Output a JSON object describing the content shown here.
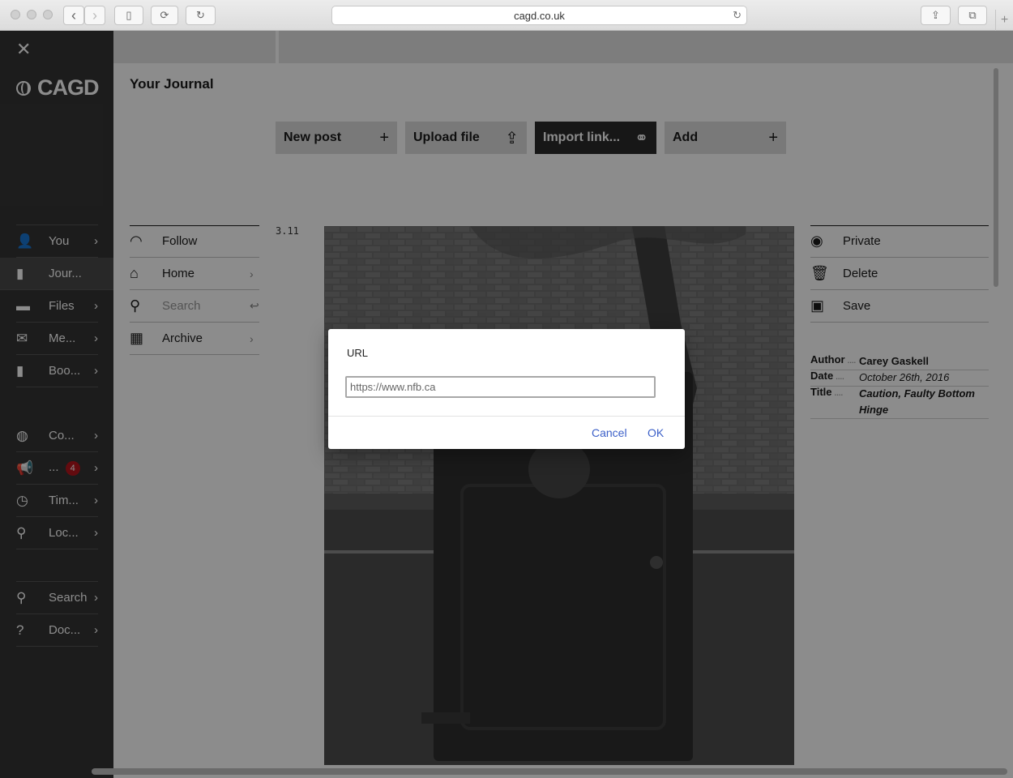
{
  "browser": {
    "url": "cagd.co.uk",
    "back_glyph": "‹",
    "forward_glyph": "›",
    "sidebar_glyph": "▯",
    "extension_glyph": "⟳",
    "reload_glyph": "↻",
    "share_glyph": "⇪",
    "tabs_glyph": "⧉",
    "new_tab_glyph": "+"
  },
  "sidebar": {
    "close_glyph": "✕",
    "logo_text": "CAGD",
    "items": [
      {
        "label": "You",
        "icon": "user-icon",
        "glyph": "👤",
        "chev": "›"
      },
      {
        "label": "Jour...",
        "icon": "journal-icon",
        "glyph": "▮",
        "chev": ""
      },
      {
        "label": "Files",
        "icon": "folder-icon",
        "glyph": "▬",
        "chev": "›"
      },
      {
        "label": "Me...",
        "icon": "mail-icon",
        "glyph": "✉",
        "chev": "›"
      },
      {
        "label": "Boo...",
        "icon": "bookmark-icon",
        "glyph": "▮",
        "chev": "›"
      },
      {
        "label": "Co...",
        "icon": "globe-icon",
        "glyph": "◍",
        "chev": "›"
      },
      {
        "label": "...",
        "icon": "megaphone-icon",
        "glyph": "📢",
        "chev": "›",
        "badge": "4"
      },
      {
        "label": "Tim...",
        "icon": "clock-icon",
        "glyph": "◷",
        "chev": "›"
      },
      {
        "label": "Loc...",
        "icon": "location-pin-icon",
        "glyph": "⚲",
        "chev": "›"
      },
      {
        "label": "Search",
        "icon": "search-icon",
        "glyph": "⚲",
        "chev": "›"
      },
      {
        "label": "Doc...",
        "icon": "help-icon",
        "glyph": "?",
        "chev": "›"
      }
    ]
  },
  "main": {
    "title": "Your Journal",
    "actions": [
      {
        "label": "New post",
        "icon": "plus-icon",
        "glyph": "+"
      },
      {
        "label": "Upload file",
        "icon": "upload-icon",
        "glyph": "⇪"
      },
      {
        "label": "Import link...",
        "icon": "paperclip-icon",
        "glyph": "⚭"
      },
      {
        "label": "Add",
        "icon": "plus-icon",
        "glyph": "+"
      }
    ],
    "left_nav": [
      {
        "label": "Follow",
        "icon": "rss-icon",
        "glyph": "◠",
        "chev": ""
      },
      {
        "label": "Home",
        "icon": "home-icon",
        "glyph": "⌂",
        "chev": "›"
      },
      {
        "label": "Search",
        "icon": "search-icon",
        "glyph": "⚲",
        "chev": "↩"
      },
      {
        "label": "Archive",
        "icon": "calendar-grid-icon",
        "glyph": "▦",
        "chev": "›"
      }
    ],
    "post_number": "3.11",
    "right_nav": [
      {
        "label": "Private",
        "icon": "eye-slash-icon",
        "glyph": "◉"
      },
      {
        "label": "Delete",
        "icon": "trash-icon",
        "glyph": "🗑"
      },
      {
        "label": "Save",
        "icon": "save-icon",
        "glyph": "▣"
      }
    ],
    "meta": {
      "author_key": "Author",
      "author": "Carey Gaskell",
      "date_key": "Date",
      "date": "October 26th, 2016",
      "title_key": "Title",
      "title": "Caution, Faulty Bottom Hinge"
    }
  },
  "dialog": {
    "label": "URL",
    "url_value": "https://www.nfb.ca",
    "cancel_label": "Cancel",
    "ok_label": "OK"
  }
}
